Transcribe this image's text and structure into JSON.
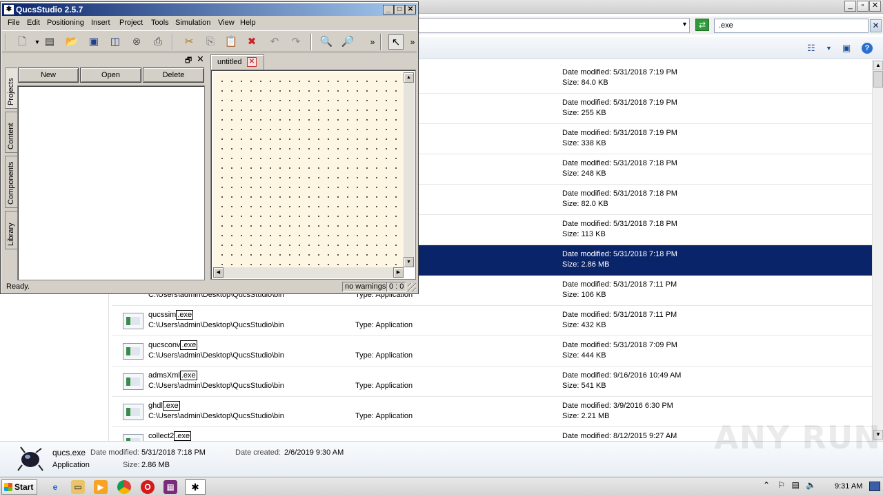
{
  "qucs": {
    "title": "QucsStudio 2.5.7",
    "menu": [
      "File",
      "Edit",
      "Positioning",
      "Insert",
      "Project",
      "Tools",
      "Simulation",
      "View",
      "Help"
    ],
    "dock_tabs": [
      "Projects",
      "Content",
      "Components",
      "Library"
    ],
    "project_buttons": {
      "new": "New",
      "open": "Open",
      "delete": "Delete"
    },
    "doc_tab": "untitled",
    "status": {
      "text": "Ready.",
      "warnings": "no warnings",
      "position": "0 : 0"
    }
  },
  "explorer": {
    "search_value": ".exe",
    "results": [
      {
        "date": "Date modified: 5/31/2018 7:19 PM",
        "size": "Size: 84.0 KB"
      },
      {
        "date": "Date modified: 5/31/2018 7:19 PM",
        "size": "Size: 255 KB"
      },
      {
        "date": "Date modified: 5/31/2018 7:19 PM",
        "size": "Size: 338 KB"
      },
      {
        "date": "Date modified: 5/31/2018 7:18 PM",
        "size": "Size: 248 KB"
      },
      {
        "date": "Date modified: 5/31/2018 7:18 PM",
        "size": "Size: 82.0 KB"
      },
      {
        "date": "Date modified: 5/31/2018 7:18 PM",
        "size": "Size: 113 KB"
      },
      {
        "date": "Date modified: 5/31/2018 7:18 PM",
        "size": "Size: 2.86 MB",
        "selected": true
      },
      {
        "path": "C:\\Users\\admin\\Desktop\\QucsStudio\\bin",
        "type": "Type: Application",
        "date": "Date modified: 5/31/2018 7:11 PM",
        "size": "Size: 106 KB"
      },
      {
        "name": "qucssim",
        "ext": ".exe",
        "path": "C:\\Users\\admin\\Desktop\\QucsStudio\\bin",
        "type": "Type: Application",
        "date": "Date modified: 5/31/2018 7:11 PM",
        "size": "Size: 432 KB"
      },
      {
        "name": "qucsconv",
        "ext": ".exe",
        "path": "C:\\Users\\admin\\Desktop\\QucsStudio\\bin",
        "type": "Type: Application",
        "date": "Date modified: 5/31/2018 7:09 PM",
        "size": "Size: 444 KB"
      },
      {
        "name": "admsXml",
        "ext": ".exe",
        "path": "C:\\Users\\admin\\Desktop\\QucsStudio\\bin",
        "type": "Type: Application",
        "date": "Date modified: 9/16/2016 10:49 AM",
        "size": "Size: 541 KB"
      },
      {
        "name": "ghdl",
        "ext": ".exe",
        "path": "C:\\Users\\admin\\Desktop\\QucsStudio\\bin",
        "type": "Type: Application",
        "date": "Date modified: 3/9/2016 6:30 PM",
        "size": "Size: 2.21 MB"
      },
      {
        "name": "collect2",
        "ext": ".exe",
        "date": "Date modified: 8/12/2015 9:27 AM"
      }
    ],
    "details": {
      "filename": "qucs.exe",
      "date_modified_label": "Date modified:",
      "date_modified": "5/31/2018 7:18 PM",
      "date_created_label": "Date created:",
      "date_created": "2/6/2019 9:30 AM",
      "kind": "Application",
      "size_label": "Size:",
      "size": "2.86 MB"
    },
    "watermark": "ANY RUN"
  },
  "taskbar": {
    "start": "Start",
    "clock": "9:31 AM"
  },
  "colors": {
    "selection": "#0a246a",
    "canvas": "#fdf6e3",
    "title_active": "#0a246a"
  }
}
